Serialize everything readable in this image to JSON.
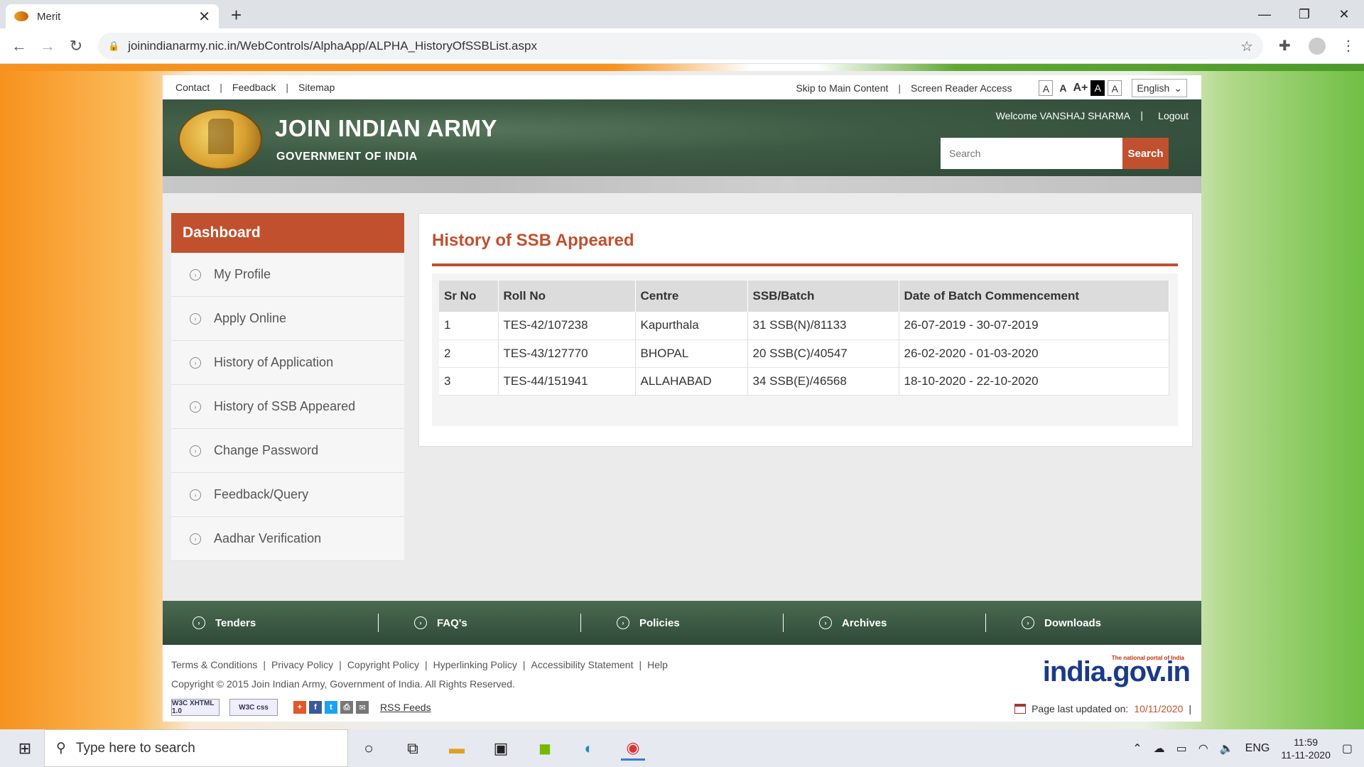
{
  "browser": {
    "tab_title": "Merit",
    "tab_close": "✕",
    "new_tab": "+",
    "url": "joinindianarmy.nic.in/WebControls/AlphaApp/ALPHA_HistoryOfSSBList.aspx"
  },
  "util": {
    "left_links": [
      "Contact",
      "Feedback",
      "Sitemap"
    ],
    "skip_main": "Skip to Main Content",
    "screen_reader": "Screen Reader Access",
    "font_sizes": [
      "A",
      "A",
      "A+",
      "A",
      "A"
    ],
    "language": "English"
  },
  "header": {
    "title": "JOIN INDIAN ARMY",
    "subtitle": "GOVERNMENT OF INDIA",
    "welcome": "Welcome VANSHAJ SHARMA",
    "logout": "Logout",
    "search_placeholder": "Search",
    "search_button": "Search"
  },
  "sidebar": {
    "heading": "Dashboard",
    "items": [
      {
        "label": "My Profile"
      },
      {
        "label": "Apply Online"
      },
      {
        "label": "History of Application"
      },
      {
        "label": "History of SSB Appeared"
      },
      {
        "label": "Change Password"
      },
      {
        "label": "Feedback/Query"
      },
      {
        "label": "Aadhar Verification"
      }
    ]
  },
  "panel": {
    "title": "History of SSB Appeared",
    "columns": [
      "Sr No",
      "Roll No",
      "Centre",
      "SSB/Batch",
      "Date of Batch Commencement"
    ],
    "rows": [
      [
        "1",
        "TES-42/107238",
        "Kapurthala",
        "31 SSB(N)/81133",
        "26-07-2019 - 30-07-2019"
      ],
      [
        "2",
        "TES-43/127770",
        "BHOPAL",
        "20 SSB(C)/40547",
        "26-02-2020 - 01-03-2020"
      ],
      [
        "3",
        "TES-44/151941",
        "ALLAHABAD",
        "34 SSB(E)/46568",
        "18-10-2020 - 22-10-2020"
      ]
    ]
  },
  "footer_nav": [
    "Tenders",
    "FAQ's",
    "Policies",
    "Archives",
    "Downloads"
  ],
  "footer": {
    "links": [
      "Terms & Conditions",
      "Privacy Policy",
      "Copyright Policy",
      "Hyperlinking Policy",
      "Accessibility Statement",
      "Help"
    ],
    "copyright": "Copyright © 2015 Join Indian Army, Government of India. All Rights Reserved.",
    "badge_xhtml": "W3C XHTML 1.0",
    "badge_css": "W3C css",
    "rss": "RSS Feeds",
    "portal_tagline": "The national portal of India",
    "portal_logo": "india.gov.in",
    "last_updated_label": "Page last updated on:",
    "last_updated_date": "10/11/2020",
    "last_updated_sep": "|"
  },
  "taskbar": {
    "search_placeholder": "Type here to search",
    "lang": "ENG",
    "time": "11:59",
    "date": "11-11-2020"
  },
  "colors": {
    "accent": "#c1502e",
    "header_green": "#3d5a44"
  }
}
